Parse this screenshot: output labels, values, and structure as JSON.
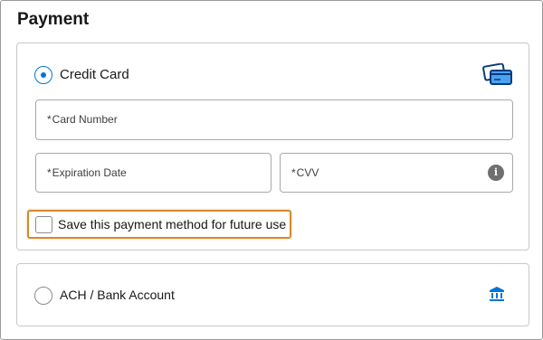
{
  "page": {
    "title": "Payment"
  },
  "credit_card": {
    "label": "Credit Card",
    "selected": true,
    "icon": "credit-card-icon",
    "accent": "#0176d3",
    "card_number": {
      "required_mark": "*",
      "placeholder": "Card Number"
    },
    "expiration": {
      "required_mark": "*",
      "placeholder": "Expiration Date"
    },
    "cvv": {
      "required_mark": "*",
      "placeholder": "CVV",
      "info_icon": "i"
    },
    "save": {
      "label": "Save this payment method for future use",
      "checked": false
    }
  },
  "ach": {
    "label": "ACH / Bank Account",
    "selected": false,
    "icon": "bank-icon"
  },
  "colors": {
    "highlight_border": "#d58a2a",
    "brand_blue": "#0176d3"
  }
}
